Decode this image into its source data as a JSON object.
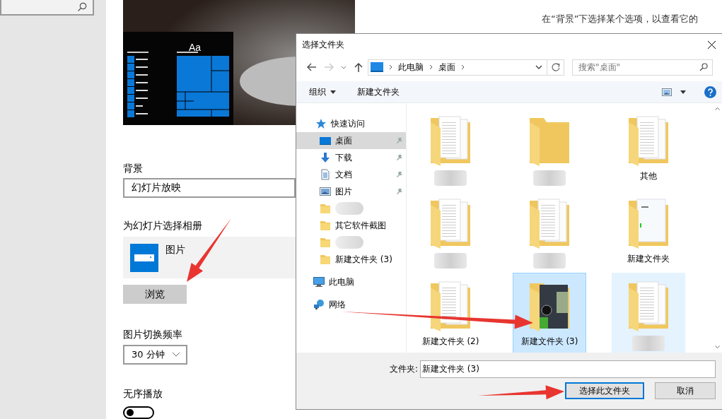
{
  "settings": {
    "preview": {
      "tile_text": "Aa"
    },
    "description": "在“背景”下选择某个选项，以查看它的",
    "background": {
      "label": "背景",
      "value": "幻灯片放映"
    },
    "album": {
      "label": "为幻灯片选择相册",
      "item": "图片",
      "browse": "浏览"
    },
    "interval": {
      "label": "图片切换频率",
      "value": "30 分钟"
    },
    "shuffle": {
      "label": "无序播放",
      "on": false
    }
  },
  "dialog": {
    "title": "选择文件夹",
    "breadcrumb": [
      "此电脑",
      "桌面"
    ],
    "search": {
      "placeholder": "搜索\"桌面\""
    },
    "toolbar": {
      "organize": "组织",
      "new_folder": "新建文件夹"
    },
    "nav_tree": [
      {
        "kind": "star",
        "label": "快速访问",
        "selected": false,
        "pinned": false,
        "children": [
          {
            "kind": "desktop",
            "label": "桌面",
            "selected": true,
            "pinned": true
          },
          {
            "kind": "download",
            "label": "下载",
            "selected": false,
            "pinned": true
          },
          {
            "kind": "document",
            "label": "文档",
            "selected": false,
            "pinned": true
          },
          {
            "kind": "picture",
            "label": "图片",
            "selected": false,
            "pinned": true
          },
          {
            "kind": "redacted",
            "selected": false,
            "pinned": false
          },
          {
            "kind": "folder",
            "label": "其它软件截图",
            "selected": false,
            "pinned": false
          },
          {
            "kind": "redacted",
            "selected": false,
            "pinned": false
          },
          {
            "kind": "folder",
            "label": "新建文件夹 (3)",
            "selected": false,
            "pinned": false
          }
        ]
      },
      {
        "kind": "computer",
        "label": "此电脑",
        "selected": false,
        "pinned": false
      },
      {
        "kind": "network",
        "label": "网络",
        "selected": false,
        "pinned": false
      }
    ],
    "items": [
      {
        "kind": "documents",
        "blurred": true,
        "selected": false,
        "hovered": false
      },
      {
        "kind": "empty",
        "blurred": true,
        "selected": false,
        "hovered": false
      },
      {
        "kind": "documents",
        "blurred": false,
        "label": "其他",
        "selected": false,
        "hovered": false
      },
      {
        "kind": "documents",
        "blurred": true,
        "selected": false,
        "hovered": false
      },
      {
        "kind": "documents",
        "blurred": true,
        "selected": false,
        "hovered": false
      },
      {
        "kind": "cover",
        "blurred": false,
        "label": "新建文件夹",
        "selected": false,
        "hovered": false
      },
      {
        "kind": "documents",
        "blurred": false,
        "label": "新建文件夹 (2)",
        "selected": false,
        "hovered": false
      },
      {
        "kind": "photo",
        "blurred": false,
        "label": "新建文件夹 (3)",
        "selected": true,
        "hovered": false
      },
      {
        "kind": "documents",
        "blurred": true,
        "selected": false,
        "hovered": true
      }
    ],
    "folder_label": "文件夹:",
    "folder_value": "新建文件夹 (3)",
    "buttons": [
      {
        "label": "选择此文件夹",
        "default": true
      },
      {
        "label": "取消",
        "default": false
      }
    ]
  }
}
